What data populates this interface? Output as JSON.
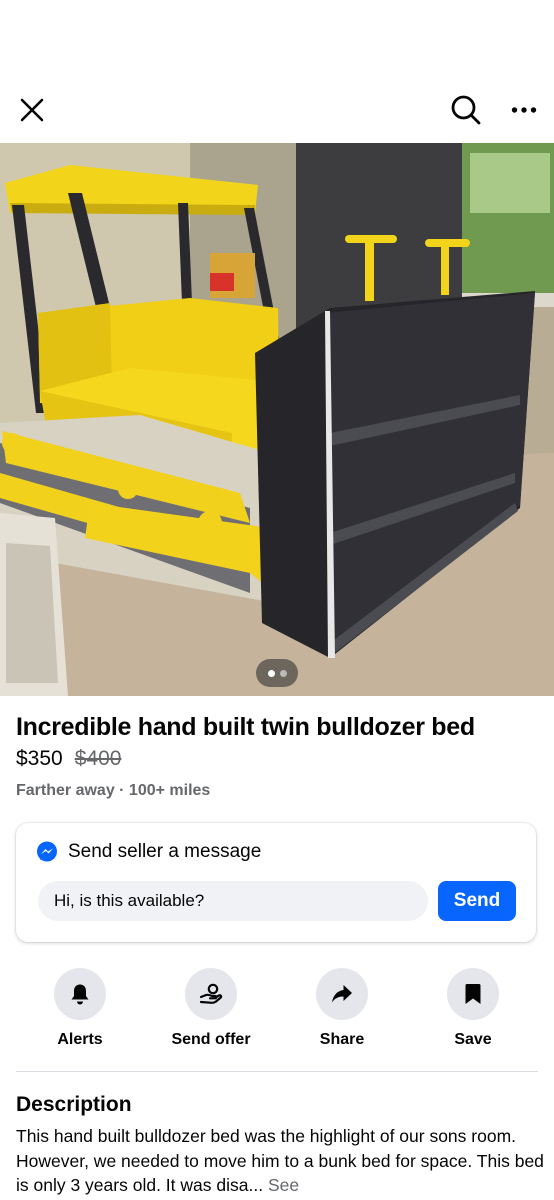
{
  "header": {
    "close_icon": "close-icon",
    "search_icon": "search-icon",
    "more_icon": "more-horizontal-icon"
  },
  "photo": {
    "alt_subject": "bulldozer bed photo",
    "carousel_count": 2,
    "carousel_active_index": 0
  },
  "listing": {
    "title": "Incredible hand built twin bulldozer bed",
    "price": "$350",
    "original_price": "$400",
    "location": "Farther away · 100+ miles"
  },
  "message": {
    "heading": "Send seller a message",
    "input_value": "Hi, is this available?",
    "send_label": "Send",
    "icon": "messenger-icon"
  },
  "actions": [
    {
      "label": "Alerts",
      "icon": "bell-icon"
    },
    {
      "label": "Send offer",
      "icon": "offer-hand-icon"
    },
    {
      "label": "Share",
      "icon": "share-arrow-icon"
    },
    {
      "label": "Save",
      "icon": "bookmark-icon"
    }
  ],
  "description": {
    "heading": "Description",
    "body": "This hand built bulldozer bed was the highlight of our sons room.  However, we needed to move him to a bunk bed for space.  This bed is only 3 years old.  It was disa...",
    "see_more": "See"
  },
  "colors": {
    "accent": "#0866ff",
    "secondary_text": "#65676b",
    "button_bg": "#e4e6eb",
    "bed_yellow": "#f2d51b"
  }
}
